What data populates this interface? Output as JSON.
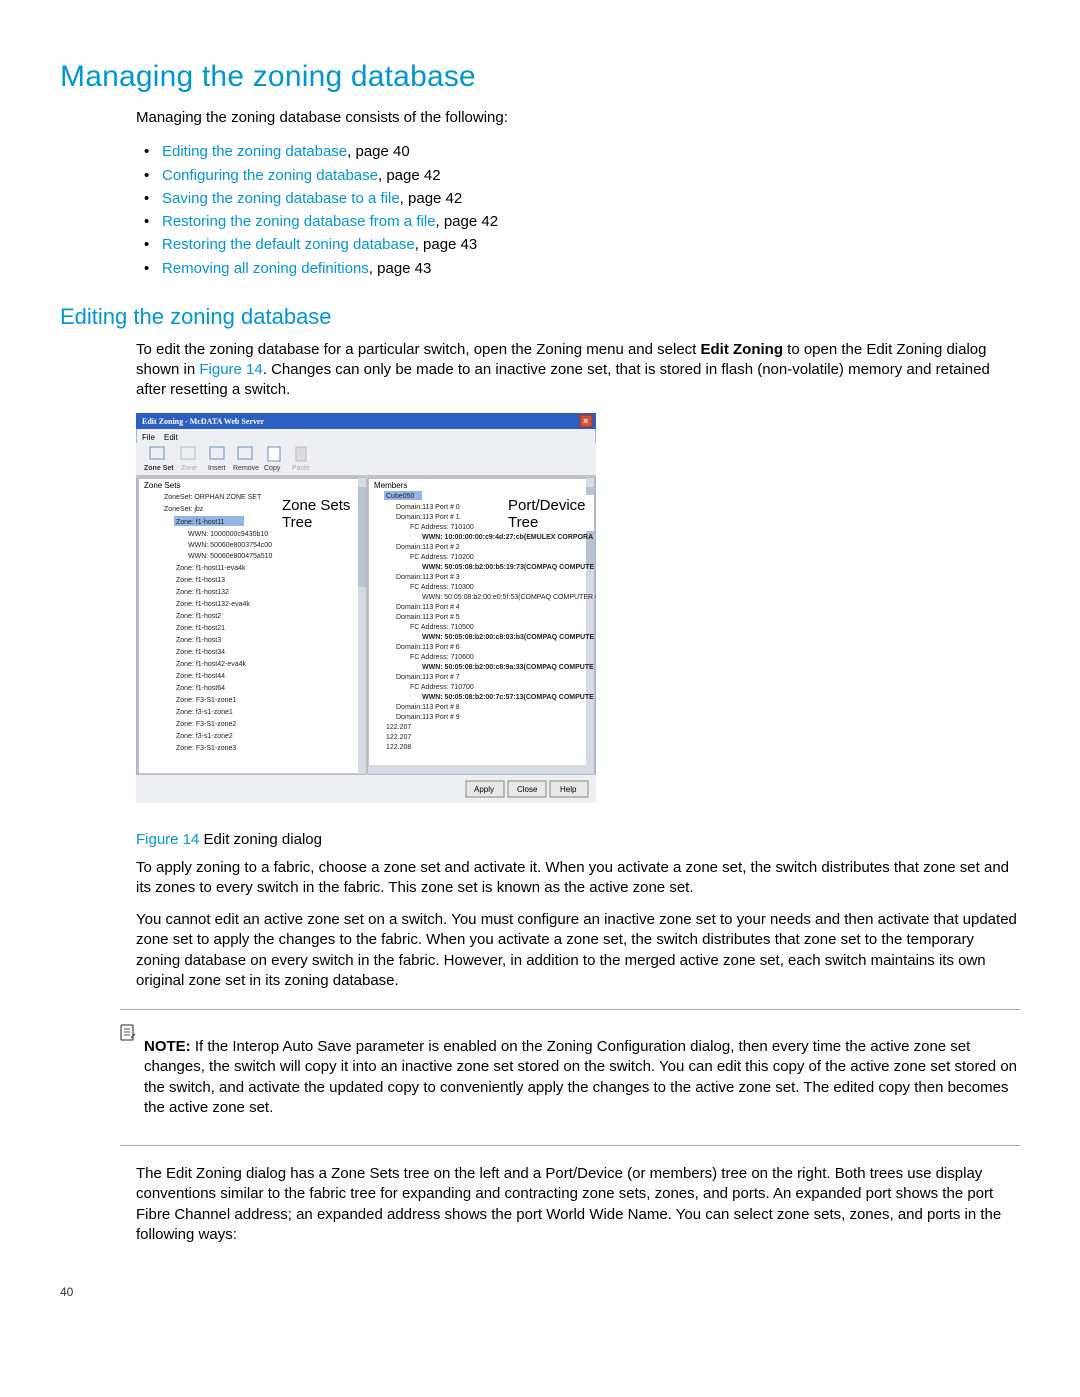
{
  "headings": {
    "h1": "Managing the zoning database",
    "h2_edit": "Editing the zoning database"
  },
  "intro": "Managing the zoning database consists of the following:",
  "bullets": [
    {
      "link": "Editing the zoning database",
      "suffix": ", page 40"
    },
    {
      "link": "Configuring the zoning database",
      "suffix": ", page 42"
    },
    {
      "link": "Saving the zoning database to a file",
      "suffix": ", page 42"
    },
    {
      "link": "Restoring the zoning database from a file",
      "suffix": ", page 42"
    },
    {
      "link": "Restoring the default zoning database",
      "suffix": ", page 43"
    },
    {
      "link": "Removing all zoning definitions",
      "suffix": ", page 43"
    }
  ],
  "edit_paragraph": {
    "pre": "To edit the zoning database for a particular switch, open the Zoning menu and select ",
    "bold": "Edit Zoning",
    "mid": " to open the Edit Zoning dialog shown in ",
    "fig_link": "Figure 14",
    "post": ". Changes can only be made to an inactive zone set, that is stored in flash (non-volatile) memory and retained after resetting a switch."
  },
  "figure": {
    "title_bar": "Edit Zoning - McDATA Web Server",
    "menu_file": "File",
    "menu_edit": "Edit",
    "tb_zoneset": "Zone Set",
    "tb_zone": "Zone",
    "tb_insert": "Insert",
    "tb_remove": "Remove",
    "tb_copy": "Copy",
    "tb_paste": "Paste",
    "left_root": "Zone Sets",
    "overlay_left1": "Zone Sets",
    "overlay_left2": "Tree",
    "overlay_right1": "Port/Device",
    "overlay_right2": "Tree",
    "right_root": "Members",
    "btn_apply": "Apply",
    "btn_close": "Close",
    "btn_help": "Help",
    "left_tree": {
      "zs1": "ZoneSet: ORPHAN ZONE SET",
      "zs2": "ZoneSet: jbz",
      "z1": "Zone: f1-host11",
      "w1": "WWN: 1000000c9430b10",
      "w2": "WWN: 50060e8003754c00",
      "w3": "WWN: 50060e800475a510",
      "z2": "Zone: f1-host11-eva4k",
      "z3": "Zone: f1-host13",
      "z4": "Zone: f1-host132",
      "z5": "Zone: f1-host132-eva4k",
      "z6": "Zone: f1-host2",
      "z7": "Zone: f1-host21",
      "z8": "Zone: f1-host3",
      "z9": "Zone: f1-host34",
      "z10": "Zone: f1-host42-eva4k",
      "z11": "Zone: f1-host44",
      "z12": "Zone: f1-host64",
      "z13": "Zone: F3-S1-zone1",
      "z14": "Zone: f3-s1-zone1",
      "z15": "Zone: F3-S1-zone2",
      "z16": "Zone: f3-s1-zone2",
      "z17": "Zone: F3-S1-zone3"
    },
    "right_tree": {
      "cube": "Cube050",
      "d0": "Domain:113 Port # 0",
      "d1": "Domain:113 Port # 1",
      "fc1": "FC Address: 710100",
      "w1": "WWN: 10:00:00:00:c9:4d:27:cb(EMULEX CORPORA",
      "d2": "Domain:113 Port # 2",
      "fc2": "FC Address: 710200",
      "w2": "WWN: 50:05:08:b2:00:b5:19:73(COMPAQ COMPUTE",
      "d3": "Domain:113 Port # 3",
      "fc3": "FC Address: 710300",
      "w3": "WWN: 50:05:08:b2:00:e0:5f:53(COMPAQ COMPUTER C",
      "d4": "Domain:113 Port # 4",
      "d5": "Domain:113 Port # 5",
      "fc5": "FC Address: 710500",
      "w5": "WWN: 50:05:08:b2:00:c8:03:b3(COMPAQ COMPUTE",
      "d6": "Domain:113 Port # 6",
      "fc6": "FC Address: 710600",
      "w6": "WWN: 50:05:08:b2:00:c8:9a:33(COMPAQ COMPUTE",
      "d7": "Domain:113 Port # 7",
      "fc7": "FC Address: 710700",
      "w7": "WWN: 50:05:08:b2:00:7c:57:13(COMPAQ COMPUTE",
      "d8": "Domain:113 Port # 8",
      "d9": "Domain:113 Port # 9",
      "n1": "122.207",
      "n2": "122.207",
      "n3": "122.208"
    }
  },
  "caption": {
    "label": "Figure 14",
    "text": "  Edit zoning dialog"
  },
  "para_apply": "To apply zoning to a fabric, choose a zone set and activate it. When you activate a zone set, the switch distributes that zone set and its zones to every switch in the fabric. This zone set is known as the active zone set.",
  "para_cannot": "You cannot edit an active zone set on a switch. You must configure an inactive zone set to your needs and then activate that updated zone set to apply the changes to the fabric. When you activate a zone set, the switch distributes that zone set to the temporary zoning database on every switch in the fabric. However, in addition to the merged active zone set, each switch maintains its own original zone set in its zoning database.",
  "note": {
    "label": "NOTE:",
    "text": "   If the Interop Auto Save parameter is enabled on the Zoning Configuration dialog, then every time the active zone set changes, the switch will copy it into an inactive zone set stored on the switch. You can edit this copy of the active zone set stored on the switch, and activate the updated copy to conveniently apply the changes to the active zone set. The edited copy then becomes the active zone set."
  },
  "para_trees": "The Edit Zoning dialog has a Zone Sets tree on the left and a Port/Device (or members) tree on the right. Both trees use display conventions similar to the fabric tree for expanding and contracting zone sets, zones, and ports. An expanded port shows the port Fibre Channel address; an expanded address shows the port World Wide Name. You can select zone sets, zones, and ports in the following ways:",
  "page_number": "40"
}
